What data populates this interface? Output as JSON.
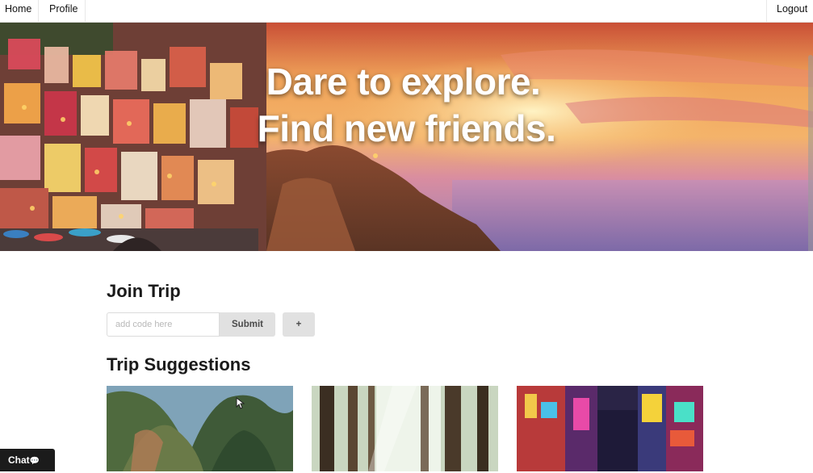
{
  "nav": {
    "home": "Home",
    "profile": "Profile",
    "logout": "Logout"
  },
  "hero": {
    "line1": "Dare to explore.",
    "line2": "Find new friends."
  },
  "join": {
    "title": "Join Trip",
    "input_placeholder": "add code here",
    "submit_label": "Submit",
    "add_label": "+"
  },
  "suggestions": {
    "title": "Trip Suggestions"
  },
  "chat": {
    "label": "Chat",
    "icon": "💬"
  },
  "colors": {
    "button_bg": "#e1e1e1",
    "chat_bg": "#1b1b1b"
  }
}
